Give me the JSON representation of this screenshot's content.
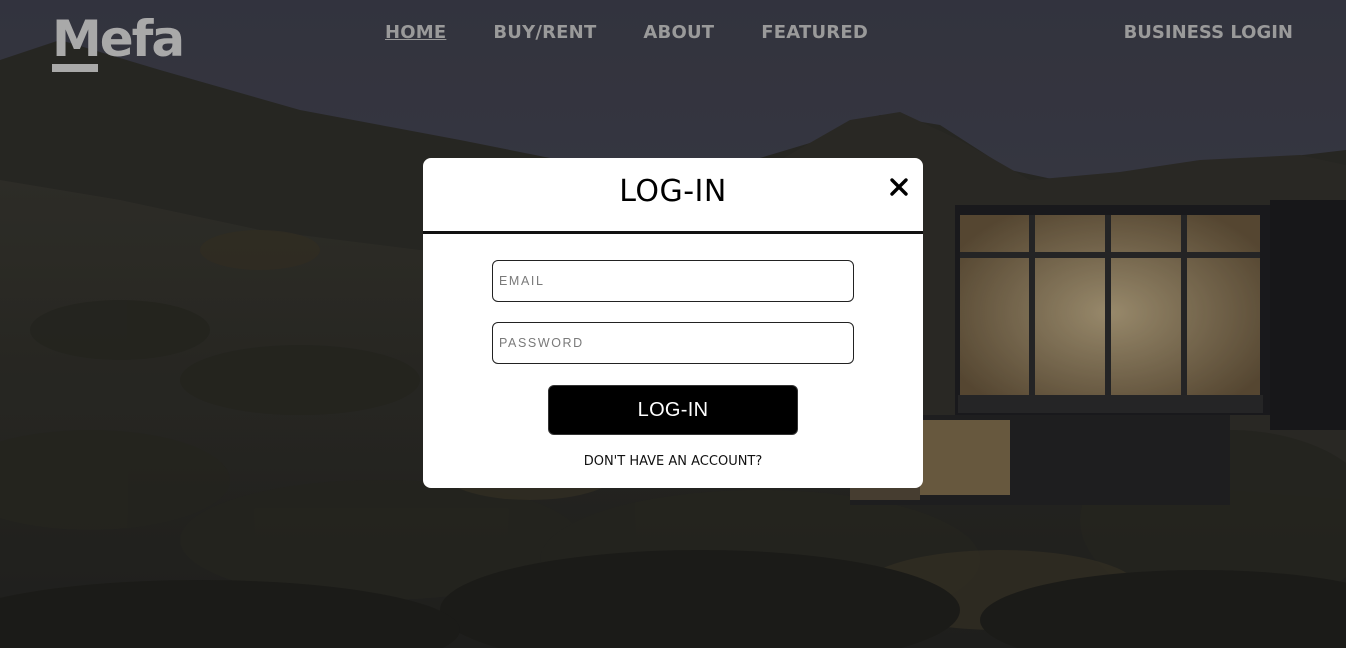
{
  "brand": {
    "logo_text": "Mefa"
  },
  "nav": {
    "items": [
      {
        "label": "HOME",
        "active": true
      },
      {
        "label": "BUY/RENT",
        "active": false
      },
      {
        "label": "ABOUT",
        "active": false
      },
      {
        "label": "FEATURED",
        "active": false
      }
    ],
    "business_login": "BUSINESS LOGIN"
  },
  "modal": {
    "title": "LOG-IN",
    "close_icon": "close-icon",
    "email_placeholder": "EMAIL",
    "email_value": "",
    "password_placeholder": "PASSWORD",
    "password_value": "",
    "submit_label": "LOG-IN",
    "signup_link": "DON'T HAVE AN ACCOUNT?"
  },
  "colors": {
    "nav_text": "#9a9a9a",
    "modal_bg": "#ffffff",
    "button_bg": "#000000"
  }
}
